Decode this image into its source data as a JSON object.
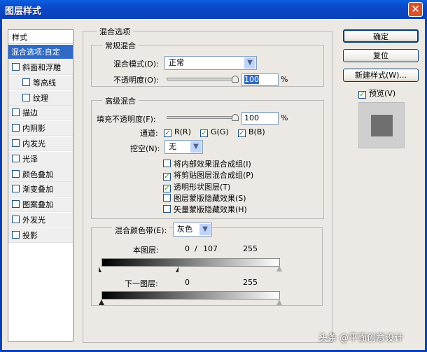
{
  "window": {
    "title": "图层样式",
    "close": "✕"
  },
  "sidebar": {
    "header": "样式",
    "items": [
      {
        "label": "混合选项:自定",
        "selected": true
      },
      {
        "label": "斜面和浮雕",
        "checked": false
      },
      {
        "label": "等高线",
        "checked": false,
        "indent": true
      },
      {
        "label": "纹理",
        "checked": false,
        "indent": true
      },
      {
        "label": "描边",
        "checked": false
      },
      {
        "label": "内阴影",
        "checked": false
      },
      {
        "label": "内发光",
        "checked": false
      },
      {
        "label": "光泽",
        "checked": false
      },
      {
        "label": "颜色叠加",
        "checked": false
      },
      {
        "label": "渐变叠加",
        "checked": false
      },
      {
        "label": "图案叠加",
        "checked": false
      },
      {
        "label": "外发光",
        "checked": false
      },
      {
        "label": "投影",
        "checked": false
      }
    ]
  },
  "blending": {
    "title": "混合选项",
    "general": {
      "title": "常规混合",
      "mode_label": "混合模式(D):",
      "mode_value": "正常",
      "opacity_label": "不透明度(O):",
      "opacity_value": "100",
      "percent": "%"
    },
    "advanced": {
      "title": "高级混合",
      "fill_label": "填充不透明度(F):",
      "fill_value": "100",
      "percent": "%",
      "channels_label": "通道:",
      "channels": [
        {
          "label": "R(R)",
          "checked": true
        },
        {
          "label": "G(G)",
          "checked": true
        },
        {
          "label": "B(B)",
          "checked": true
        }
      ],
      "knockout_label": "挖空(N):",
      "knockout_value": "无",
      "options": [
        {
          "label": "将内部效果混合成组(I)",
          "checked": false
        },
        {
          "label": "将剪贴图层混合成组(P)",
          "checked": true
        },
        {
          "label": "透明形状图层(T)",
          "checked": true
        },
        {
          "label": "图层蒙版隐藏效果(S)",
          "checked": false
        },
        {
          "label": "矢量蒙版隐藏效果(H)",
          "checked": false
        }
      ]
    },
    "blend_if": {
      "label": "混合颜色带(E):",
      "value": "灰色",
      "this_layer_label": "本图层:",
      "this_low": "0",
      "this_sep": "/",
      "this_split": "107",
      "this_high": "255",
      "underlying_label": "下一图层:",
      "under_low": "0",
      "under_high": "255"
    }
  },
  "buttons": {
    "ok": "确定",
    "reset": "复位",
    "new_style": "新建样式(W)...",
    "preview_label": "预览(V)",
    "preview_checked": true
  },
  "watermark": "头条 @平面创意设计"
}
